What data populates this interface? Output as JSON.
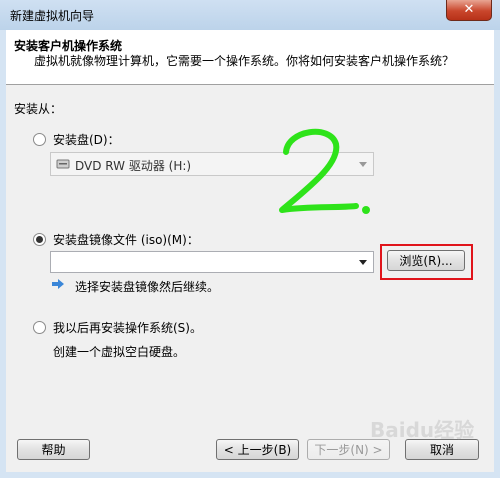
{
  "window": {
    "title": "新建虚拟机向导",
    "close_glyph": "✕"
  },
  "header": {
    "title": "安装客户机操作系统",
    "subtitle": "虚拟机就像物理计算机，它需要一个操作系统。你将如何安装客户机操作系统？"
  },
  "install_from_label": "安装从：",
  "options": {
    "disc": {
      "label": "安装盘(D)：",
      "selected": false,
      "drive_value": "DVD RW 驱动器 (H:)"
    },
    "iso": {
      "label": "安装盘镜像文件 (iso)(M)：",
      "selected": true,
      "path_value": "",
      "browse_label": "浏览(R)...",
      "hint": "选择安装盘镜像然后继续。"
    },
    "later": {
      "label": "我以后再安装操作系统(S)。",
      "selected": false,
      "description": "创建一个虚拟空白硬盘。"
    }
  },
  "annotation_text": "2.",
  "watermark_text": "Baidu经验",
  "buttons": {
    "help": "帮助",
    "back": "< 上一步(B)",
    "next": "下一步(N) >",
    "cancel": "取消"
  },
  "colors": {
    "highlight": "#e0141b",
    "annotation": "#2ee31a",
    "info_arrow": "#3a86d8"
  }
}
